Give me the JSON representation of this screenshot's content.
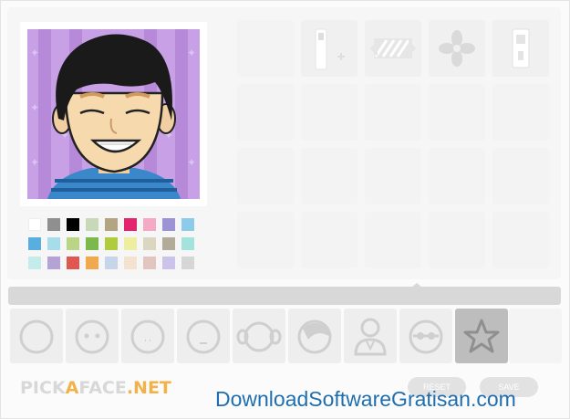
{
  "logo": {
    "part1": "PICK",
    "part2": "A",
    "part3": "FACE",
    "part4": ".NET"
  },
  "buttons": {
    "reset": "RESET",
    "save": "SAVE"
  },
  "watermark": "DownloadSoftwareGratisan.com",
  "palette": [
    "#ffffff",
    "#8f8f8f",
    "#000000",
    "#c8d9b9",
    "#b3a582",
    "#e3246f",
    "#f5a9c5",
    "#9b93d6",
    "#8ccbea",
    "#59aee0",
    "#a7dcea",
    "#b9d585",
    "#7bb94c",
    "#b0cc3c",
    "#eeeea0",
    "#dbd6c0",
    "#b2ab99",
    "#a4e3dc",
    "#c4eceb",
    "#b5a3d8",
    "#e0574f",
    "#f2a94e",
    "#c6d5e9",
    "#f4e2d1",
    "#e3c5c0",
    "#cbc3ea",
    "#d6d6d6"
  ],
  "tabs": [
    {
      "icon": "face-shape-icon"
    },
    {
      "icon": "eyes-icon"
    },
    {
      "icon": "nose-icon"
    },
    {
      "icon": "mouth-icon"
    },
    {
      "icon": "ears-icon"
    },
    {
      "icon": "hair-icon"
    },
    {
      "icon": "clothes-icon"
    },
    {
      "icon": "glasses-icon"
    },
    {
      "icon": "extras-star-icon"
    },
    {
      "icon": "blank-tab"
    }
  ],
  "active_tab": "extras-star-icon",
  "options": [
    {
      "icon": "empty-option"
    },
    {
      "icon": "wand-sparkle-icon"
    },
    {
      "icon": "striped-badge-icon"
    },
    {
      "icon": "flower-ornament-icon"
    },
    {
      "icon": "phone-device-icon"
    }
  ]
}
